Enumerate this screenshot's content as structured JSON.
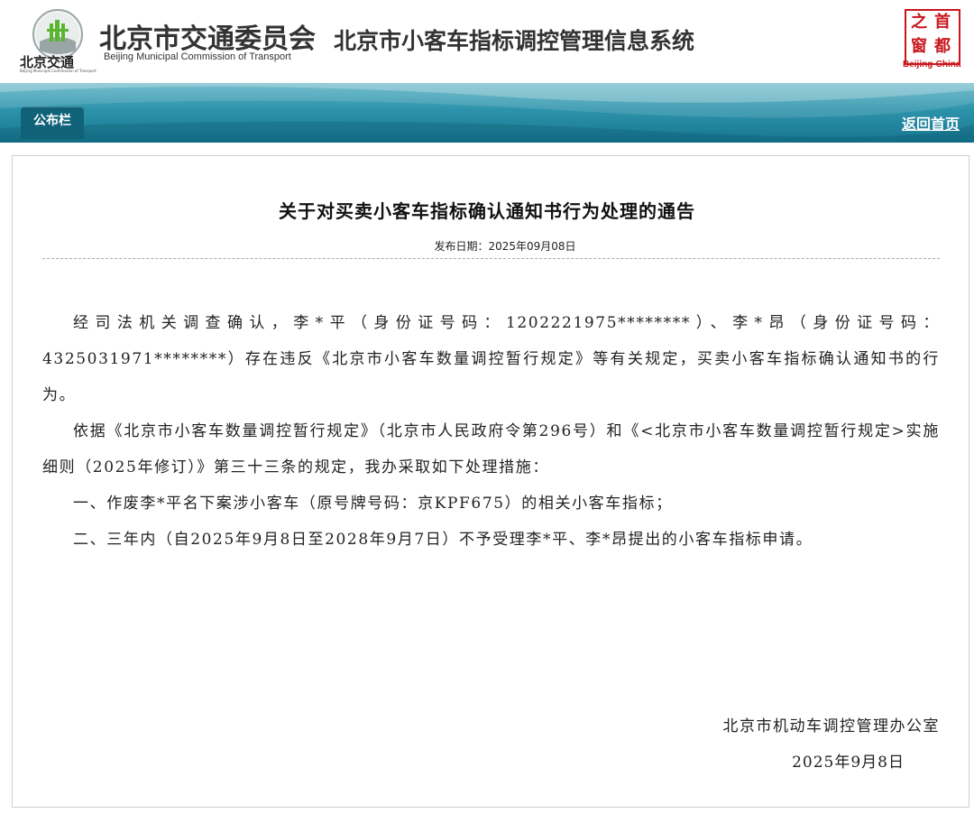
{
  "header": {
    "logo_text": "北京交通",
    "logo_subtext": "Beijing Municipal Commission of Transport",
    "org_name_cn": "北京市交通委员会",
    "org_name_en": "Beijing Municipal Commission of Transport",
    "system_title": "北京市小客车指标调控管理信息系统",
    "seal_chars": [
      "首",
      "都",
      "之",
      "窗"
    ],
    "seal_caption": "Beijing·China"
  },
  "nav": {
    "tab_label": "公布栏",
    "back_link": "返回首页"
  },
  "notice": {
    "title": "关于对买卖小客车指标确认通知书行为处理的通告",
    "publish_date": "发布日期：2025年09月08日",
    "paragraphs": [
      "经司法机关调查确认，李*平（身份证号码：1202221975********）、李*昂（身份证号码：4325031971********）存在违反《北京市小客车数量调控暂行规定》等有关规定，买卖小客车指标确认通知书的行为。",
      "依据《北京市小客车数量调控暂行规定》（北京市人民政府令第296号）和《<北京市小客车数量调控暂行规定>实施细则（2025年修订）》第三十三条的规定，我办采取如下处理措施：",
      "一、作废李*平名下案涉小客车（原号牌号码：京KPF675）的相关小客车指标；",
      "二、三年内（自2025年9月8日至2028年9月7日）不予受理李*平、李*昂提出的小客车指标申请。"
    ],
    "signature_office": "北京市机动车调控管理办公室",
    "signature_date": "2025年9月8日"
  },
  "colors": {
    "nav_band": "#2d93ab",
    "nav_tab": "#0f6278",
    "seal_red": "#c8161d"
  }
}
